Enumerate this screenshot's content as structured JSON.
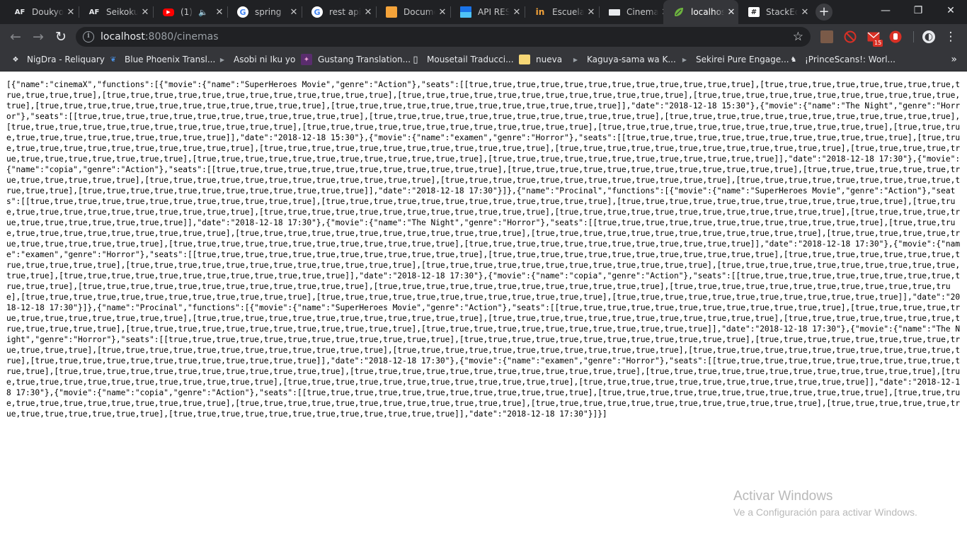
{
  "browser": {
    "tabs": [
      {
        "title": "Doukyo",
        "icon": "af-icon",
        "icon_text": "AF"
      },
      {
        "title": "Seikoku",
        "icon": "af-icon",
        "icon_text": "AF"
      },
      {
        "title": "(1)",
        "icon": "youtube-icon",
        "icon_text": "▶",
        "muted_icon": "speaker-icon"
      },
      {
        "title": "spring",
        "icon": "google-icon",
        "icon_text": "G"
      },
      {
        "title": "rest api",
        "icon": "google-icon",
        "icon_text": "G"
      },
      {
        "title": "Document",
        "icon": "document-icon",
        "icon_text": ""
      },
      {
        "title": "API REST",
        "icon": "api-icon",
        "icon_text": ""
      },
      {
        "title": "Escuela",
        "icon": "escuela-icon",
        "icon_text": "in"
      },
      {
        "title": "Cinemas",
        "icon": "cinema-icon",
        "icon_text": ""
      },
      {
        "title": "localhost",
        "icon": "spring-leaf-icon",
        "icon_text": "",
        "active": true
      },
      {
        "title": "StackEdit",
        "icon": "stackedit-icon",
        "icon_text": "#"
      }
    ],
    "tab_close_glyph": "✕",
    "new_tab_glyph": "+",
    "window_controls": {
      "minimize": "—",
      "restore": "❐",
      "close": "✕"
    },
    "nav": {
      "back": "←",
      "forward": "→",
      "reload": "↻"
    },
    "address": {
      "host": "localhost",
      "port_path": ":8080/cinemas"
    },
    "bookmark_star": "☆",
    "extensions": [
      {
        "icon": "profile-photo-icon",
        "glyph": "👤",
        "color": "#7a5a48"
      },
      {
        "icon": "no-entry-icon",
        "glyph": "⊘",
        "color": "#d93025"
      },
      {
        "icon": "mail-icon",
        "glyph": "✉",
        "color": "#d93025"
      },
      {
        "icon": "hand-stop-icon",
        "glyph": "✋",
        "color": "#d93025"
      }
    ],
    "mail_badge": "15",
    "account_avatar_glyph": "◐",
    "menu_glyph": "⋮",
    "bookmarks": [
      {
        "label": "NigDra - Reliquary",
        "icon": "dragon-icon",
        "glyph": "❖"
      },
      {
        "label": "Blue Phoenix Transl...",
        "icon": "phoenix-icon",
        "glyph": "❦"
      },
      {
        "label": "Asobi ni Iku yo",
        "icon": "video-icon",
        "glyph": "▶"
      },
      {
        "label": "Gustang Translation...",
        "icon": "gustang-icon",
        "glyph": "✦"
      },
      {
        "label": "Mousetail Traducci...",
        "icon": "page-icon",
        "glyph": "▯"
      },
      {
        "label": "nueva",
        "icon": "folder-icon",
        "glyph": "▬"
      },
      {
        "label": "Kaguya-sama wa K...",
        "icon": "video-icon",
        "glyph": "▶"
      },
      {
        "label": "Sekirei Pure Engage...",
        "icon": "video-icon",
        "glyph": "▶"
      },
      {
        "label": "¡PrinceScans!: Worl...",
        "icon": "prince-icon",
        "glyph": "♞"
      }
    ],
    "bookmarks_more": "»"
  },
  "page": {
    "json_text": "[{\"name\":\"cinemaX\",\"functions\":[{\"movie\":{\"name\":\"SuperHeroes Movie\",\"genre\":\"Action\"},\"seats\":[[true,true,true,true,true,true,true,true,true,true,true,true],[true,true,true,true,true,true,true,true,true,true,true,true],[true,true,true,true,true,true,true,true,true,true,true,true],[true,true,true,true,true,true,true,true,true,true,true,true],[true,true,true,true,true,true,true,true,true,true,true,true],[true,true,true,true,true,true,true,true,true,true,true,true],[true,true,true,true,true,true,true,true,true,true,true,true]],\"date\":\"2018-12-18 15:30\"},{\"movie\":{\"name\":\"The Night\",\"genre\":\"Horror\"},\"seats\":[[true,true,true,true,true,true,true,true,true,true,true,true],[true,true,true,true,true,true,true,true,true,true,true,true],[true,true,true,true,true,true,true,true,true,true,true,true],[true,true,true,true,true,true,true,true,true,true,true,true],[true,true,true,true,true,true,true,true,true,true,true,true],[true,true,true,true,true,true,true,true,true,true,true,true],[true,true,true,true,true,true,true,true,true,true,true,true]],\"date\":\"2018-12-18 15:30\"},{\"movie\":{\"name\":\"examen\",\"genre\":\"Horror\"},\"seats\":[[true,true,true,true,true,true,true,true,true,true,true,true],[true,true,true,true,true,true,true,true,true,true,true,true],[true,true,true,true,true,true,true,true,true,true,true,true],[true,true,true,true,true,true,true,true,true,true,true,true],[true,true,true,true,true,true,true,true,true,true,true,true],[true,true,true,true,true,true,true,true,true,true,true,true],[true,true,true,true,true,true,true,true,true,true,true,true]],\"date\":\"2018-12-18 17:30\"},{\"movie\":{\"name\":\"copia\",\"genre\":\"Action\"},\"seats\":[[true,true,true,true,true,true,true,true,true,true,true,true],[true,true,true,true,true,true,true,true,true,true,true,true],[true,true,true,true,true,true,true,true,true,true,true,true],[true,true,true,true,true,true,true,true,true,true,true,true],[true,true,true,true,true,true,true,true,true,true,true,true],[true,true,true,true,true,true,true,true,true,true,true,true],[true,true,true,true,true,true,true,true,true,true,true,true]],\"date\":\"2018-12-18 17:30\"}]},{\"name\":\"Procinal\",\"functions\":[{\"movie\":{\"name\":\"SuperHeroes Movie\",\"genre\":\"Action\"},\"seats\":[[true,true,true,true,true,true,true,true,true,true,true,true],[true,true,true,true,true,true,true,true,true,true,true,true],[true,true,true,true,true,true,true,true,true,true,true,true],[true,true,true,true,true,true,true,true,true,true,true,true],[true,true,true,true,true,true,true,true,true,true,true,true],[true,true,true,true,true,true,true,true,true,true,true,true],[true,true,true,true,true,true,true,true,true,true,true,true]],\"date\":\"2018-12-18 17:30\"},{\"movie\":{\"name\":\"The Night\",\"genre\":\"Horror\"},\"seats\":[[true,true,true,true,true,true,true,true,true,true,true,true],[true,true,true,true,true,true,true,true,true,true,true,true],[true,true,true,true,true,true,true,true,true,true,true,true],[true,true,true,true,true,true,true,true,true,true,true,true],[true,true,true,true,true,true,true,true,true,true,true,true],[true,true,true,true,true,true,true,true,true,true,true,true],[true,true,true,true,true,true,true,true,true,true,true,true]],\"date\":\"2018-12-18 17:30\"},{\"movie\":{\"name\":\"examen\",\"genre\":\"Horror\"},\"seats\":[[true,true,true,true,true,true,true,true,true,true,true,true],[true,true,true,true,true,true,true,true,true,true,true,true],[true,true,true,true,true,true,true,true,true,true,true,true],[true,true,true,true,true,true,true,true,true,true,true,true],[true,true,true,true,true,true,true,true,true,true,true,true],[true,true,true,true,true,true,true,true,true,true,true,true],[true,true,true,true,true,true,true,true,true,true,true,true]],\"date\":\"2018-12-18 17:30\"},{\"movie\":{\"name\":\"copia\",\"genre\":\"Action\"},\"seats\":[[true,true,true,true,true,true,true,true,true,true,true,true],[true,true,true,true,true,true,true,true,true,true,true,true],[true,true,true,true,true,true,true,true,true,true,true,true],[true,true,true,true,true,true,true,true,true,true,true,true],[true,true,true,true,true,true,true,true,true,true,true,true],[true,true,true,true,true,true,true,true,true,true,true,true],[true,true,true,true,true,true,true,true,true,true,true,true]],\"date\":\"2018-12-18 17:30\"}]},{\"name\":\"Procinal\",\"functions\":[{\"movie\":{\"name\":\"SuperHeroes Movie\",\"genre\":\"Action\"},\"seats\":[[true,true,true,true,true,true,true,true,true,true,true,true],[true,true,true,true,true,true,true,true,true,true,true,true],[true,true,true,true,true,true,true,true,true,true,true,true],[true,true,true,true,true,true,true,true,true,true,true,true],[true,true,true,true,true,true,true,true,true,true,true,true],[true,true,true,true,true,true,true,true,true,true,true,true],[true,true,true,true,true,true,true,true,true,true,true,true]],\"date\":\"2018-12-18 17:30\"},{\"movie\":{\"name\":\"The Night\",\"genre\":\"Horror\"},\"seats\":[[true,true,true,true,true,true,true,true,true,true,true,true],[true,true,true,true,true,true,true,true,true,true,true,true],[true,true,true,true,true,true,true,true,true,true,true,true],[true,true,true,true,true,true,true,true,true,true,true,true],[true,true,true,true,true,true,true,true,true,true,true,true],[true,true,true,true,true,true,true,true,true,true,true,true],[true,true,true,true,true,true,true,true,true,true,true,true]],\"date\":\"2018-12-18 17:30\"},{\"movie\":{\"name\":\"examen\",\"genre\":\"Horror\"},\"seats\":[[true,true,true,true,true,true,true,true,true,true,true,true],[true,true,true,true,true,true,true,true,true,true,true,true],[true,true,true,true,true,true,true,true,true,true,true,true],[true,true,true,true,true,true,true,true,true,true,true,true],[true,true,true,true,true,true,true,true,true,true,true,true],[true,true,true,true,true,true,true,true,true,true,true,true],[true,true,true,true,true,true,true,true,true,true,true,true]],\"date\":\"2018-12-18 17:30\"},{\"movie\":{\"name\":\"copia\",\"genre\":\"Action\"},\"seats\":[[true,true,true,true,true,true,true,true,true,true,true,true],[true,true,true,true,true,true,true,true,true,true,true,true],[true,true,true,true,true,true,true,true,true,true,true,true],[true,true,true,true,true,true,true,true,true,true,true,true],[true,true,true,true,true,true,true,true,true,true,true,true],[true,true,true,true,true,true,true,true,true,true,true,true],[true,true,true,true,true,true,true,true,true,true,true,true]],\"date\":\"2018-12-18 17:30\"}]}]"
  },
  "watermark": {
    "title": "Activar Windows",
    "subtitle": "Ve a Configuración para activar Windows."
  },
  "colors": {
    "tabstrip_bg": "#202124",
    "toolbar_bg": "#35363a",
    "omnibox_bg": "#202124",
    "page_bg": "#ffffff"
  }
}
